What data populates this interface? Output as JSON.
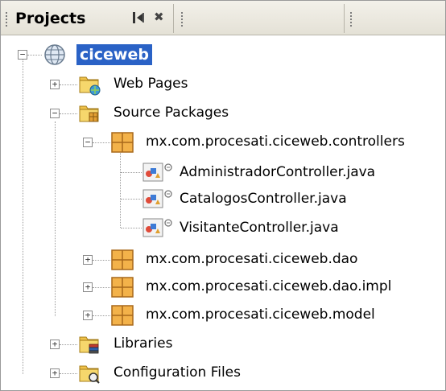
{
  "panel": {
    "title": "Projects",
    "pin_icon": "minimize-window-icon",
    "close_icon": "close-icon"
  },
  "tree": {
    "root": {
      "label": "ciceweb",
      "icon": "web-project-globe-icon",
      "expanded": true
    },
    "web_pages": {
      "label": "Web Pages",
      "icon": "web-folder-icon",
      "expanded": false
    },
    "source_packages": {
      "label": "Source Packages",
      "icon": "source-folder-icon",
      "expanded": true
    },
    "packages": [
      {
        "label": "mx.com.procesati.ciceweb.controllers",
        "expanded": true
      },
      {
        "label": "mx.com.procesati.ciceweb.dao",
        "expanded": false
      },
      {
        "label": "mx.com.procesati.ciceweb.dao.impl",
        "expanded": false
      },
      {
        "label": "mx.com.procesati.ciceweb.model",
        "expanded": false
      }
    ],
    "files": [
      {
        "label": "AdministradorController.java"
      },
      {
        "label": "CatalogosController.java"
      },
      {
        "label": "VisitanteController.java"
      }
    ],
    "libraries": {
      "label": "Libraries",
      "icon": "library-folder-icon",
      "expanded": false
    },
    "config_files": {
      "label": "Configuration Files",
      "icon": "config-folder-icon",
      "expanded": false
    }
  },
  "colors": {
    "selection": "#2a62c6",
    "header_bg": "#ece9df",
    "package": "#e8a23a"
  }
}
